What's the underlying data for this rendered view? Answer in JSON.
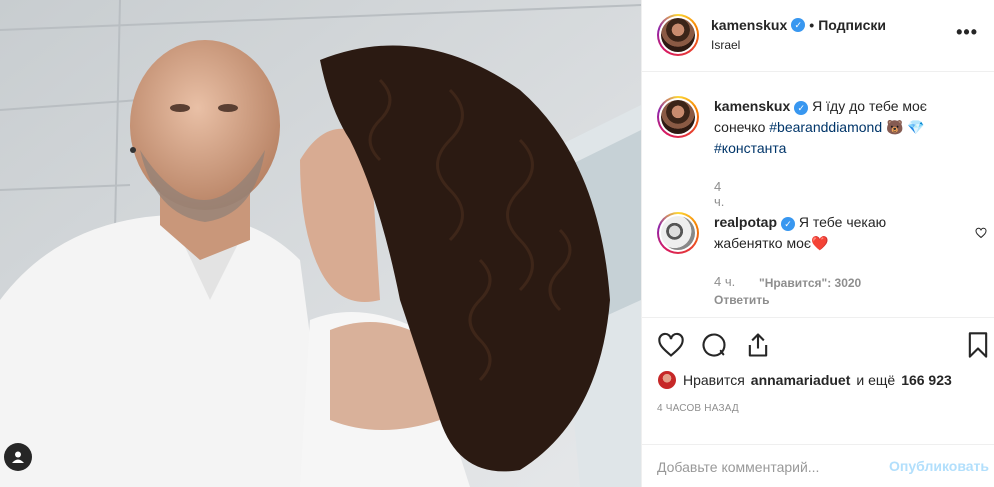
{
  "post": {
    "username": "kamenskux",
    "follow_separator": "•",
    "follow_label": "Подписки",
    "location": "Israel",
    "more_glyph": "•••"
  },
  "comments": [
    {
      "username": "kamenskux",
      "text_before": "Я їду до тебе моє сонечко ",
      "hashtag1": "#bearanddiamond",
      "emojis": "🐻 💎",
      "hashtag2": "#константа",
      "time": "4 ч."
    },
    {
      "username": "realpotap",
      "text": "Я тебе чекаю жабенятко моє",
      "emoji": "❤️",
      "time": "4 ч.",
      "likes": "\"Нравится\": 3020",
      "reply_label": "Ответить"
    }
  ],
  "likes": {
    "prefix": "Нравится",
    "user": "annamariaduet",
    "middle": "и ещё",
    "count": "166 923"
  },
  "timestamp": "4 ЧАСОВ НАЗАД",
  "comment_box": {
    "placeholder": "Добавьте комментарий...",
    "post_label": "Опубликовать"
  },
  "colors": {
    "verified": "#3897f0",
    "hashtag": "#003569",
    "muted": "#8e8e8e",
    "post_disabled": "#b2dffc",
    "like_heart": "#ed4956"
  },
  "icons": [
    "heart-icon",
    "comment-icon",
    "share-icon",
    "bookmark-icon",
    "user-tag-icon",
    "verified-icon",
    "more-icon"
  ]
}
